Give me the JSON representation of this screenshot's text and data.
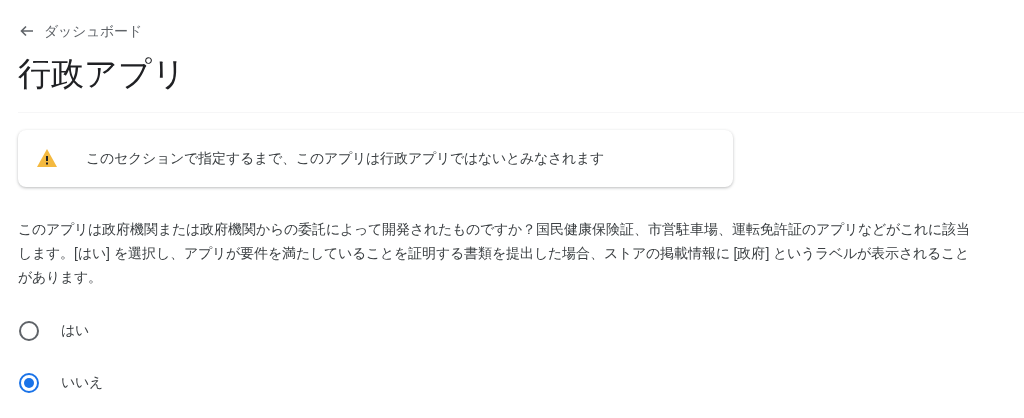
{
  "back_link": {
    "label": "ダッシュボード"
  },
  "title": "行政アプリ",
  "alert": {
    "text": "このセクションで指定するまで、このアプリは行政アプリではないとみなされます"
  },
  "description": "このアプリは政府機関または政府機関からの委託によって開発されたものですか？国民健康保険証、市営駐車場、運転免許証のアプリなどがこれに該当します。[はい] を選択し、アプリが要件を満たしていることを証明する書類を提出した場合、ストアの掲載情報に [政府] というラベルが表示されることがあります。",
  "options": [
    {
      "label": "はい",
      "selected": false
    },
    {
      "label": "いいえ",
      "selected": true
    }
  ]
}
